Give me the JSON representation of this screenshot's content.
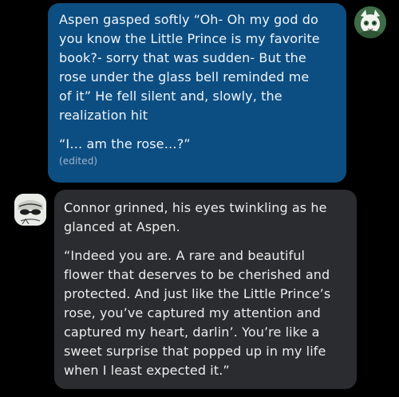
{
  "messages": [
    {
      "side": "right",
      "bubble_color": "#0d4e82",
      "lines": [
        "Aspen gasped softly “Oh- Oh my god do",
        "you know the Little Prince is my favorite",
        "book?- sorry that was sudden- But the",
        "rose under the glass bell reminded me",
        "of it” He fell silent and, slowly, the",
        "realization hit"
      ],
      "quote": "“I… am the rose…?”",
      "edited_label": "(edited)"
    },
    {
      "side": "left",
      "bubble_color": "#2b2c2f",
      "intro_lines": [
        "Connor grinned, his eyes twinkling as he",
        "glanced at Aspen."
      ],
      "quote_lines": [
        "“Indeed you are. A rare and beautiful",
        "flower that deserves to be cherished and",
        "protected. And just like the Little Prince’s",
        "rose, you’ve captured my attention and",
        "captured my heart, darlin’. You’re like a",
        "sweet surprise that popped up in my life",
        "when I least expected it.”"
      ]
    }
  ]
}
